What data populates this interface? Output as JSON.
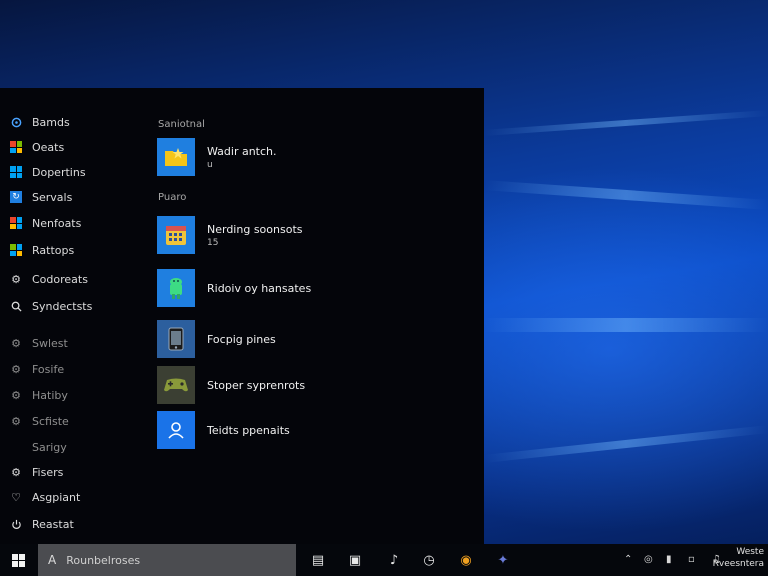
{
  "start_menu": {
    "left_items": [
      {
        "label": "Bamds",
        "icon": "settings-icon"
      },
      {
        "label": "Oeats",
        "icon": "windows-grid-icon"
      },
      {
        "label": "Dopertins",
        "icon": "windows-grid-icon"
      },
      {
        "label": "Servals",
        "icon": "refresh-icon"
      },
      {
        "label": "Nenfoats",
        "icon": "windows-grid-icon"
      },
      {
        "label": "Rattops",
        "icon": "windows-grid-icon"
      },
      {
        "label": "Codoreats",
        "icon": "gear-icon"
      },
      {
        "label": "Syndectsts",
        "icon": "search-icon"
      },
      {
        "label": "Swlest",
        "icon": "gear-icon"
      },
      {
        "label": "Fosife",
        "icon": "gear-icon"
      },
      {
        "label": "Hatiby",
        "icon": "gear-icon"
      },
      {
        "label": "Scfiste",
        "icon": "gear-icon"
      },
      {
        "label": "Sarigy",
        "icon": ""
      },
      {
        "label": "Fisers",
        "icon": "gear-icon"
      },
      {
        "label": "Asgpiant",
        "icon": "account-icon"
      },
      {
        "label": "Reastat",
        "icon": "power-icon"
      }
    ],
    "section1_label": "Saniotnal",
    "section2_label": "Puaro",
    "tiles": [
      {
        "title": "Wadir antch.",
        "sub": "u",
        "icon": "folder-star-icon"
      },
      {
        "title": "Nerding soonsots",
        "sub": "15",
        "icon": "calendar-icon"
      },
      {
        "title": "Ridoiv oy hansates",
        "sub": "",
        "icon": "android-icon"
      },
      {
        "title": "Focpig pines",
        "sub": "",
        "icon": "device-icon"
      },
      {
        "title": "Stoper syprenrots",
        "sub": "",
        "icon": "gamepad-icon"
      },
      {
        "title": "Teidts ppenaits",
        "sub": "",
        "icon": "user-icon"
      }
    ]
  },
  "taskbar": {
    "search_prefix": "A",
    "search_value": "Rounbelroses",
    "clock_time": "Weste",
    "clock_date": "Rveesntera"
  },
  "colors": {
    "accent": "#1a73e8",
    "menu_bg": "#04050a",
    "taskbar_bg": "#05070c"
  }
}
